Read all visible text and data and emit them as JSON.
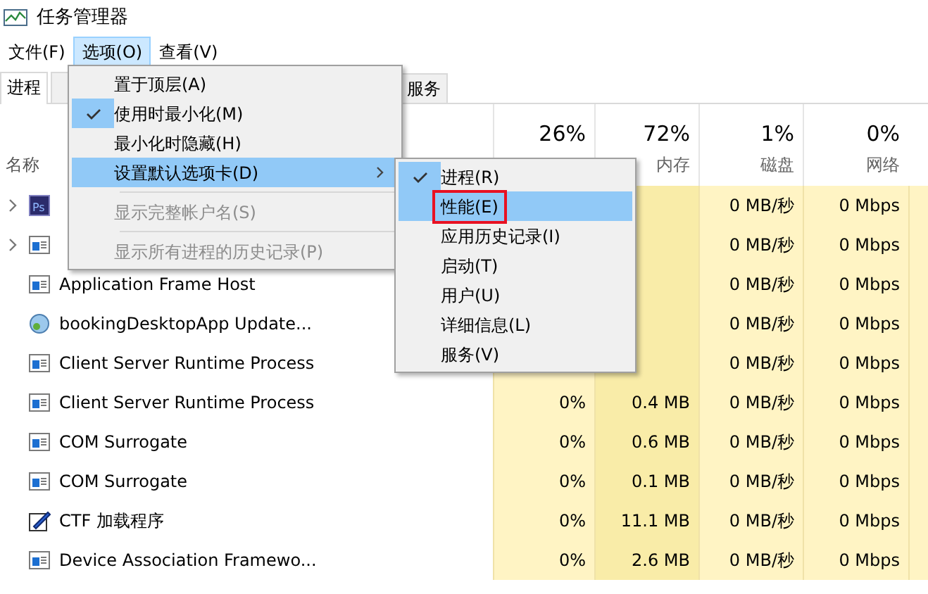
{
  "window": {
    "title": "任务管理器"
  },
  "menu_bar": [
    {
      "label": "文件(F)",
      "selected": false
    },
    {
      "label": "选项(O)",
      "selected": true
    },
    {
      "label": "查看(V)",
      "selected": false
    }
  ],
  "tabs": [
    {
      "label": "进程",
      "selected": true
    },
    {
      "selected": false
    },
    {
      "label": "服务",
      "selected": false
    }
  ],
  "table": {
    "name_header": "名称",
    "columns": [
      {
        "usage": "26%"
      },
      {
        "usage": "72%",
        "label": "内存"
      },
      {
        "usage": "1%",
        "label": "磁盘"
      },
      {
        "usage": "0%",
        "label": "网络"
      }
    ],
    "rows": [
      {
        "kind": "ps",
        "icon_text": "Ps",
        "expandable": true,
        "cells": [
          null,
          null,
          "0 MB/秒",
          "0 Mbps"
        ]
      },
      {
        "kind": "window",
        "expandable": true,
        "cells": [
          null,
          null,
          "0 MB/秒",
          "0 Mbps"
        ]
      },
      {
        "kind": "window",
        "expandable": false,
        "name": "Application Frame Host",
        "cells": [
          null,
          null,
          "0 MB/秒",
          "0 Mbps"
        ]
      },
      {
        "kind": "globe",
        "expandable": false,
        "name": "bookingDesktopApp Update...",
        "cells": [
          null,
          null,
          "0 MB/秒",
          "0 Mbps"
        ]
      },
      {
        "kind": "window",
        "expandable": false,
        "name": "Client Server Runtime Process",
        "cells": [
          null,
          null,
          "0 MB/秒",
          "0 Mbps"
        ]
      },
      {
        "kind": "window",
        "expandable": false,
        "name": "Client Server Runtime Process",
        "cells": [
          "0%",
          "0.4 MB",
          "0 MB/秒",
          "0 Mbps"
        ]
      },
      {
        "kind": "window",
        "expandable": false,
        "name": "COM Surrogate",
        "cells": [
          "0%",
          "0.6 MB",
          "0 MB/秒",
          "0 Mbps"
        ]
      },
      {
        "kind": "window",
        "expandable": false,
        "name": "COM Surrogate",
        "cells": [
          "0%",
          "0.1 MB",
          "0 MB/秒",
          "0 Mbps"
        ]
      },
      {
        "kind": "pen",
        "expandable": false,
        "name": "CTF 加载程序",
        "cells": [
          "0%",
          "11.1 MB",
          "0 MB/秒",
          "0 Mbps"
        ]
      },
      {
        "kind": "window",
        "expandable": false,
        "name": "Device Association Framewo...",
        "cells": [
          "0%",
          "2.6 MB",
          "0 MB/秒",
          "0 Mbps"
        ]
      }
    ]
  },
  "options_menu": [
    {
      "label": "置于顶层(A)",
      "checked": false,
      "disabled": false,
      "selected": false,
      "kind": "item"
    },
    {
      "label": "使用时最小化(M)",
      "checked": true,
      "disabled": false,
      "selected": false,
      "kind": "item"
    },
    {
      "label": "最小化时隐藏(H)",
      "checked": false,
      "disabled": false,
      "selected": false,
      "kind": "item"
    },
    {
      "label": "设置默认选项卡(D)",
      "checked": false,
      "disabled": false,
      "selected": true,
      "kind": "submenu"
    },
    {
      "kind": "separator"
    },
    {
      "label": "显示完整帐户名(S)",
      "checked": false,
      "disabled": true,
      "selected": false,
      "kind": "item"
    },
    {
      "kind": "separator"
    },
    {
      "label": "显示所有进程的历史记录(P)",
      "checked": false,
      "disabled": true,
      "selected": false,
      "kind": "item"
    }
  ],
  "default_tab_submenu": [
    {
      "label": "进程(R)",
      "checked": true,
      "selected": false,
      "outlined": false
    },
    {
      "label": "性能(E)",
      "checked": false,
      "selected": true,
      "outlined": true
    },
    {
      "label": "应用历史记录(I)",
      "checked": false,
      "selected": false,
      "outlined": false
    },
    {
      "label": "启动(T)",
      "checked": false,
      "selected": false,
      "outlined": false
    },
    {
      "label": "用户(U)",
      "checked": false,
      "selected": false,
      "outlined": false
    },
    {
      "label": "详细信息(L)",
      "checked": false,
      "selected": false,
      "outlined": false
    },
    {
      "label": "服务(V)",
      "checked": false,
      "selected": false,
      "outlined": false
    }
  ]
}
